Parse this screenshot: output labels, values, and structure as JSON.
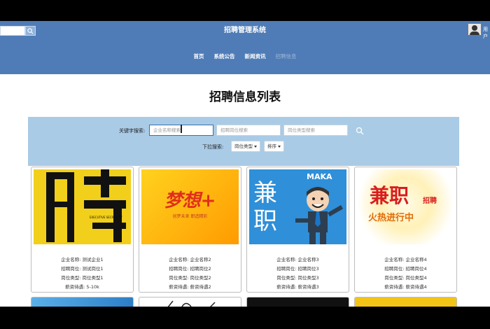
{
  "header": {
    "site_title": "招聘管理系统",
    "user_name": "用户"
  },
  "nav": [
    {
      "label": "首页"
    },
    {
      "label": "系统公告"
    },
    {
      "label": "新闻资讯"
    },
    {
      "label": "招聘信息",
      "active": true
    }
  ],
  "page": {
    "heading": "招聘信息列表"
  },
  "search": {
    "keyword_label": "关键字搜索:",
    "company_placeholder": "企业名称搜索",
    "position_placeholder": "招聘岗位搜索",
    "type_placeholder": "岗位类型搜索",
    "dropdown_label": "下拉搜索:",
    "type_dropdown": "岗位类型",
    "sort_dropdown": "排序"
  },
  "cards": [
    {
      "image_text": "聘",
      "company": "企业名称: 测试企业1",
      "position": "招聘岗位: 测试岗位1",
      "type": "岗位类型: 岗位类型1",
      "salary": "薪资待遇: 5-10k"
    },
    {
      "image_text": "梦想+",
      "image_sub": "创梦未来 职造精彩",
      "company": "企业名称: 企业名称2",
      "position": "招聘岗位: 招聘岗位2",
      "type": "岗位类型: 岗位类型2",
      "salary": "薪资待遇: 薪资待遇2"
    },
    {
      "image_text": "兼职",
      "image_brand": "MAKA",
      "company": "企业名称: 企业名称3",
      "position": "招聘岗位: 招聘岗位3",
      "type": "岗位类型: 岗位类型3",
      "salary": "薪资待遇: 薪资待遇3"
    },
    {
      "image_text": "兼职",
      "image_sub": "火热进行中",
      "image_tag": "招聘",
      "company": "企业名称: 企业名称4",
      "position": "招聘岗位: 招聘岗位4",
      "type": "岗位类型: 岗位类型4",
      "salary": "薪资待遇: 薪资待遇4"
    }
  ],
  "colors": {
    "header": "#4f7cb6",
    "panel": "#a9cbe6"
  }
}
